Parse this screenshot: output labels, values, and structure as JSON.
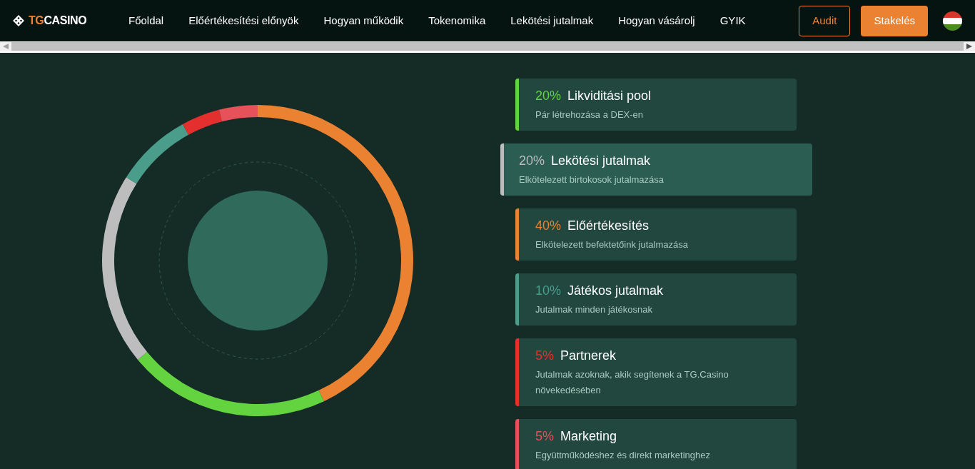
{
  "logo": {
    "accent": "TG",
    "rest": "CASINO"
  },
  "nav": [
    "Főoldal",
    "Előértékesítési előnyök",
    "Hogyan működik",
    "Tokenomika",
    "Lekötési jutalmak",
    "Hogyan vásárolj",
    "GYIK"
  ],
  "buttons": [
    {
      "label": "Audit",
      "kind": "outline"
    },
    {
      "label": "Stakelés",
      "kind": "filled"
    }
  ],
  "legend": [
    {
      "percent": "20%",
      "title": "Likviditási pool",
      "description": "Pár létrehozása a DEX-en",
      "color": "#63d33f",
      "selected": false
    },
    {
      "percent": "20%",
      "title": "Lekötési jutalmak",
      "description": "Elkötelezett birtokosok jutalmazása",
      "color": "#bdbdbd",
      "selected": true
    },
    {
      "percent": "40%",
      "title": "Előértékesítés",
      "description": "Elkötelezett befektetőink jutalmazása",
      "color": "#eb8232",
      "selected": false
    },
    {
      "percent": "10%",
      "title": "Játékos jutalmak",
      "description": "Jutalmak minden játékosnak",
      "color": "#4a9d8b",
      "selected": false
    },
    {
      "percent": "5%",
      "title": "Partnerek",
      "description": "Jutalmak azoknak, akik segítenek a TG.Casino növekedésében",
      "color": "#e3302f",
      "selected": false
    },
    {
      "percent": "5%",
      "title": "Marketing",
      "description": "Együttműködéshez és direkt marketinghez",
      "color": "#e6515a",
      "selected": false
    }
  ]
}
